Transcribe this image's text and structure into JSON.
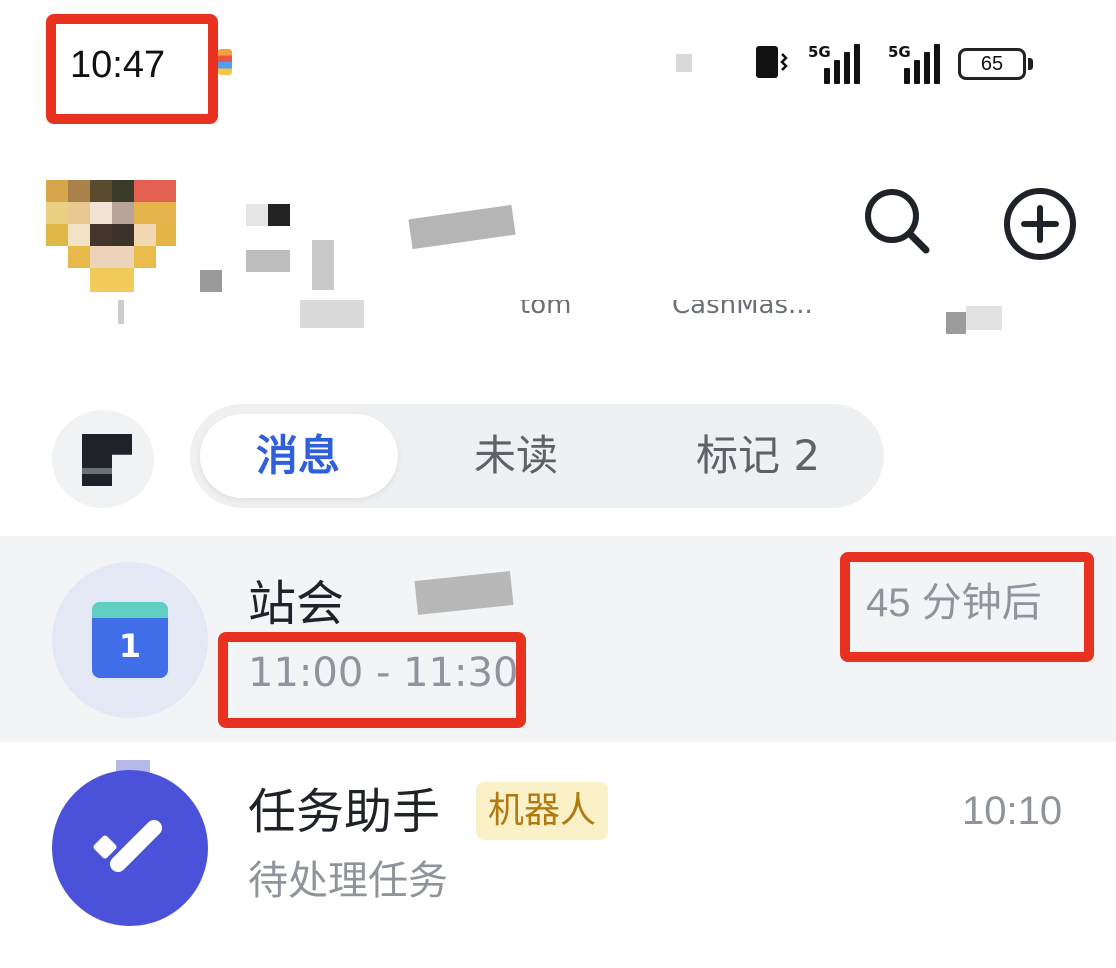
{
  "status_bar": {
    "time": "10:47",
    "network_1": "5G",
    "network_2": "5G",
    "battery": "65"
  },
  "header": {
    "search_icon": "search-icon",
    "add_icon": "plus-circle-icon"
  },
  "contacts": [
    "tom",
    "CashMas..."
  ],
  "tabs": [
    {
      "label": "消息",
      "active": true
    },
    {
      "label": "未读",
      "active": false
    },
    {
      "label": "标记 2",
      "active": false
    }
  ],
  "conversations": [
    {
      "title": "站会",
      "subtitle": "11:00 - 11:30",
      "time": "45 分钟后",
      "icon": "calendar-icon",
      "icon_text": "1",
      "highlighted": true
    },
    {
      "title": "任务助手",
      "badge": "机器人",
      "subtitle": "待处理任务",
      "time": "10:10",
      "icon": "task-check-icon"
    }
  ],
  "colors": {
    "accent": "#2f5fdc",
    "highlight_box": "#e8321f",
    "task_avatar": "#4b52d9",
    "calendar_blue": "#3f6ee8",
    "badge_bg": "#fbf1c9",
    "badge_text": "#b07a0f"
  }
}
